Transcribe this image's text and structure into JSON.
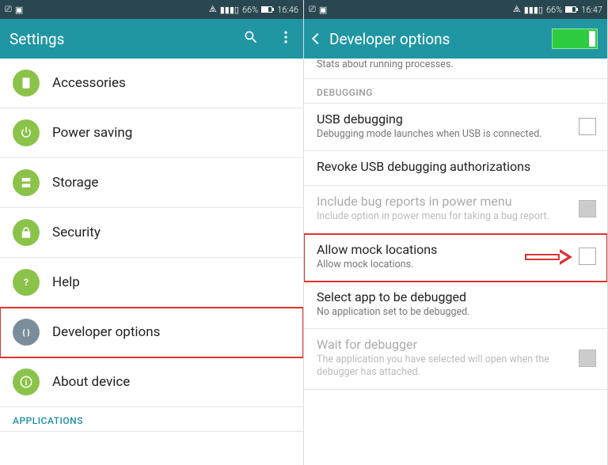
{
  "left": {
    "status": {
      "battery": "66%",
      "time": "16:46"
    },
    "title": "Settings",
    "items": [
      {
        "label": "Accessories",
        "icon": "tablet",
        "color": "#8bc34a"
      },
      {
        "label": "Power saving",
        "icon": "power",
        "color": "#8bc34a"
      },
      {
        "label": "Storage",
        "icon": "storage",
        "color": "#8bc34a"
      },
      {
        "label": "Security",
        "icon": "lock",
        "color": "#8bc34a"
      },
      {
        "label": "Help",
        "icon": "help",
        "color": "#8bc34a"
      },
      {
        "label": "Developer options",
        "icon": "braces",
        "color": "#7b8d9b"
      },
      {
        "label": "About device",
        "icon": "info",
        "color": "#8bc34a"
      }
    ],
    "section_applications": "APPLICATIONS"
  },
  "right": {
    "status": {
      "battery": "66%",
      "time": "16:47"
    },
    "title": "Developer options",
    "top_truncated_sub": "Stats about running processes.",
    "section_debugging": "DEBUGGING",
    "opts": {
      "usb": {
        "title": "USB debugging",
        "sub": "Debugging mode launches when USB is connected."
      },
      "revoke": {
        "title": "Revoke USB debugging authorizations"
      },
      "bugreport": {
        "title": "Include bug reports in power menu",
        "sub": "Include option in power menu for taking a bug report."
      },
      "mock": {
        "title": "Allow mock locations",
        "sub": "Allow mock locations."
      },
      "selectapp": {
        "title": "Select app to be debugged",
        "sub": "No application set to be debugged."
      },
      "wait": {
        "title": "Wait for debugger",
        "sub": "The application you have selected will open when the debugger has attached."
      }
    }
  }
}
